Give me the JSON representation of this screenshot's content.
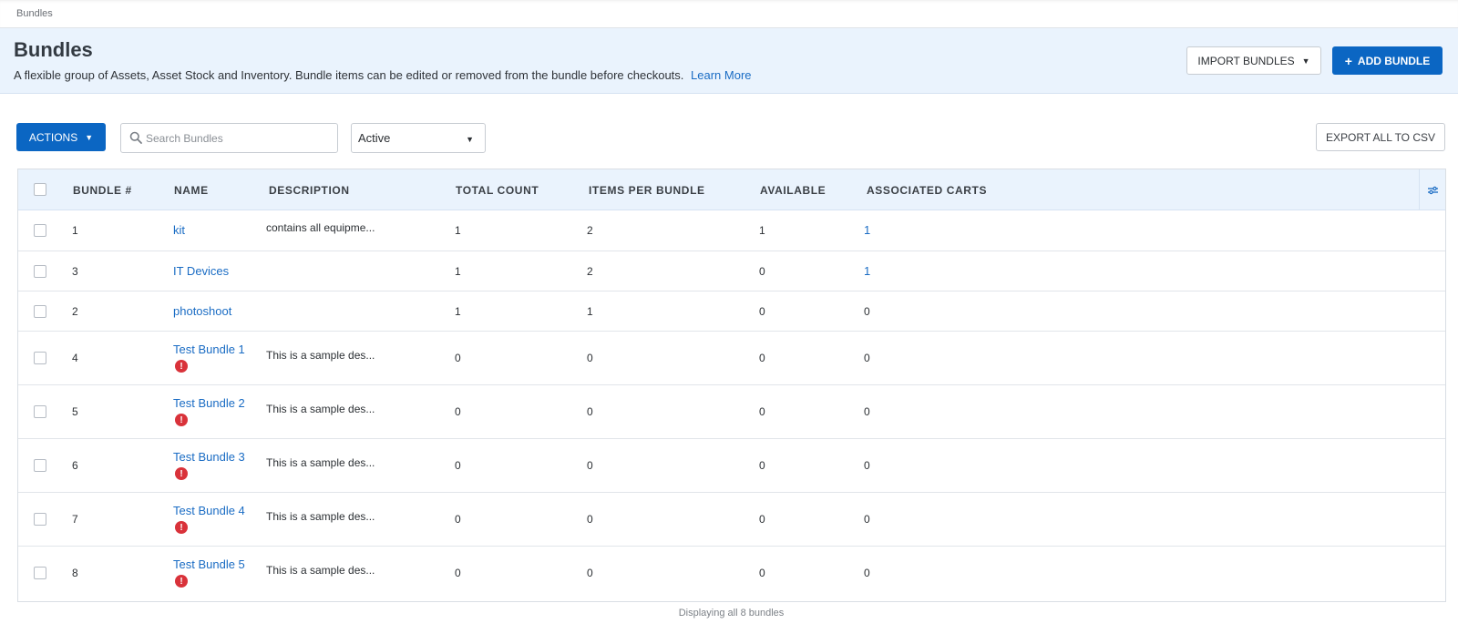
{
  "breadcrumb": "Bundles",
  "header": {
    "title": "Bundles",
    "description": "A flexible group of Assets, Asset Stock and Inventory. Bundle items can be edited or removed from the bundle before checkouts.",
    "learn_more": "Learn More",
    "import_label": "IMPORT BUNDLES",
    "add_label": "ADD BUNDLE"
  },
  "toolbar": {
    "actions_label": "ACTIONS",
    "search_placeholder": "Search Bundles",
    "status_value": "Active",
    "export_label": "EXPORT ALL TO CSV"
  },
  "table": {
    "columns": [
      "BUNDLE #",
      "NAME",
      "DESCRIPTION",
      "TOTAL COUNT",
      "ITEMS PER BUNDLE",
      "AVAILABLE",
      "ASSOCIATED CARTS"
    ],
    "rows": [
      {
        "number": "1",
        "name": "kit",
        "description": "contains all equipme...",
        "total": "1",
        "items": "2",
        "available": "1",
        "carts": "1"
      },
      {
        "number": "3",
        "name": "IT Devices",
        "description": "",
        "total": "1",
        "items": "2",
        "available": "0",
        "carts": "1"
      },
      {
        "number": "2",
        "name": "photoshoot",
        "description": "",
        "total": "1",
        "items": "1",
        "available": "0",
        "carts": "0"
      },
      {
        "number": "4",
        "name": "Test Bundle 1",
        "description": "This is a sample des...",
        "total": "0",
        "items": "0",
        "available": "0",
        "carts": "0"
      },
      {
        "number": "5",
        "name": "Test Bundle 2",
        "description": "This is a sample des...",
        "total": "0",
        "items": "0",
        "available": "0",
        "carts": "0"
      },
      {
        "number": "6",
        "name": "Test Bundle 3",
        "description": "This is a sample des...",
        "total": "0",
        "items": "0",
        "available": "0",
        "carts": "0"
      },
      {
        "number": "7",
        "name": "Test Bundle 4",
        "description": "This is a sample des...",
        "total": "0",
        "items": "0",
        "available": "0",
        "carts": "0"
      },
      {
        "number": "8",
        "name": "Test Bundle 5",
        "description": "This is a sample des...",
        "total": "0",
        "items": "0",
        "available": "0",
        "carts": "0"
      }
    ]
  },
  "footer": "Displaying all 8 bundles",
  "colors": {
    "primary": "#0b66c3",
    "link": "#1a6cc4",
    "header_bg": "#eaf3fd",
    "warning": "#d9323a"
  },
  "icons": {
    "search": "search-icon",
    "column_settings": "sliders-icon",
    "warning": "exclamation-circle-icon",
    "caret": "caret-down-icon",
    "plus": "plus-icon"
  }
}
